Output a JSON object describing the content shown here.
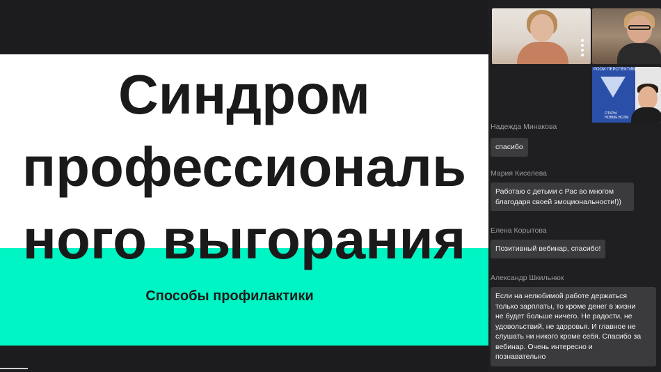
{
  "slide": {
    "title_lines": [
      "Синдром",
      "профессиональ",
      "ного выгорания"
    ],
    "subtitle": "Способы профилактики"
  },
  "video_tiles": [
    {
      "id": "participant-1"
    },
    {
      "id": "participant-2"
    },
    {
      "id": "participant-3",
      "banner_text": "РООИ ПЕРСПЕКТИВА",
      "banner_subtext": [
        "ОТКРЫ",
        "НОВЫЕ ВОЗМ"
      ]
    }
  ],
  "chat": {
    "partial_sender": "Надежда Минакова",
    "messages": [
      {
        "sender": "",
        "text": "спасибо"
      },
      {
        "sender": "Мария Киселева",
        "text_lines": [
          "Работаю с детьми с Рас во многом",
          "благодаря своей эмоциональности!))"
        ]
      },
      {
        "sender": "Елена Корытова",
        "text": "Позитивный вебинар, спасибо!"
      },
      {
        "sender": "Александр Шкильнюк",
        "text_lines": [
          "Если на нелюбимой работе держаться",
          "только зарплаты, то кроме денег в жизни",
          "не будет больше ничего. Не радости, не",
          "удовольствий, не здоровья. И главное не",
          "слушать ни никого кроме себя. Спасибо за",
          "вебинар. Очень интересно и",
          "познавательно"
        ]
      }
    ]
  },
  "colors": {
    "background": "#1c1c1e",
    "slide_band": "#00f5c4",
    "bubble": "#3b3b3d"
  }
}
